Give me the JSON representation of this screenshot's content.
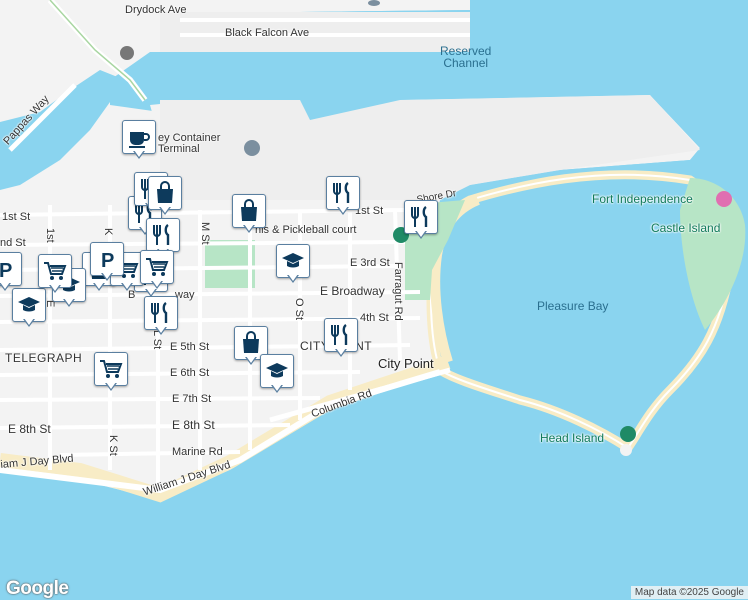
{
  "map": {
    "colors": {
      "water": "#8ad4ef",
      "land": "#f3f3f3",
      "road": "#ffffff",
      "park": "#b7e5c6",
      "beach": "#f8ecc6",
      "pin_border": "#5a7fa0",
      "icon": "#0d3a5c"
    },
    "water_labels": {
      "reserved_channel": "Reserved\nChannel",
      "pleasure_bay": "Pleasure Bay"
    },
    "place_labels": {
      "fort_independence": "Fort Independence",
      "castle_island": "Castle Island",
      "head_island": "Head Island",
      "city_point_big": "City Point",
      "city_point_small": "CITY POINT",
      "telegraph": "TELEGRAPH",
      "container_terminal": "ey Container\nTerminal",
      "tennis_court": "nis & Pickleball court"
    },
    "street_labels": {
      "drydock": "Drydock Ave",
      "black_falcon": "Black Falcon Ave",
      "pappas": "Pappas Way",
      "first_st_left": "1st St",
      "first_st_right": "1st St",
      "second_st": "nd St",
      "third_st": "E 3rd St",
      "broadway": "E Broadway",
      "broadway_left": "B",
      "broadway_left2": "way",
      "fourth_st": "4th St",
      "fifth_st": "E 5th St",
      "sixth_st": "E 6th St",
      "seventh_st": "E 7th St",
      "eighth_st_left": "E 8th St",
      "eighth_st_mid": "E 8th St",
      "marine": "Marine Rd",
      "columbia": "Columbia Rd",
      "wjd_left": "iam J Day Blvd",
      "wjd_mid": "William J Day Blvd",
      "farragut": "Farragut Rd",
      "shore": "Shore Dr",
      "m_st": "M St",
      "o_st": "O St",
      "k_st": "K St",
      "k_st_top": "K",
      "l_st": "L St",
      "first_vert": "1st",
      "e_st": "E",
      "st_fragment": "st"
    },
    "markers": [
      {
        "type": "cafe",
        "name": "cafe-marker"
      },
      {
        "type": "restaurant",
        "name": "restaurant-marker"
      },
      {
        "type": "shopping",
        "name": "shopping-marker"
      },
      {
        "type": "school",
        "name": "school-marker"
      },
      {
        "type": "grocery",
        "name": "grocery-marker"
      },
      {
        "type": "parking",
        "name": "parking-marker"
      }
    ],
    "attribution": "Map data ©2025 Google",
    "logo": "Google"
  }
}
